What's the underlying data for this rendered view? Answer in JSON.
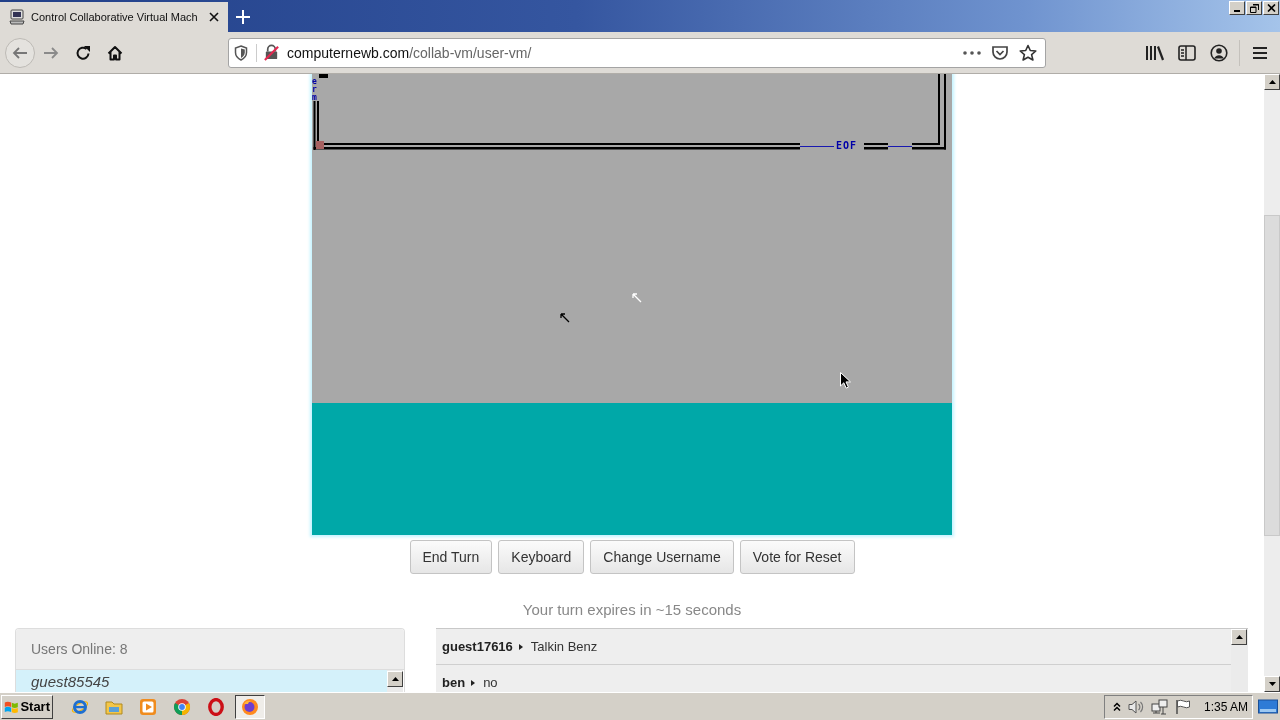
{
  "browser": {
    "tabs": [
      {
        "title": "Control Collaborative Virtual Mach",
        "selected": true
      }
    ],
    "address": {
      "host": "computernewb.com",
      "path": "/collab-vm/user-vm/"
    }
  },
  "vm_screen": {
    "vertical_label": "erm",
    "status_label": "EOF"
  },
  "controls": {
    "buttons": [
      "End Turn",
      "Keyboard",
      "Change Username",
      "Vote for Reset"
    ],
    "turn_notice": "Your turn expires in ~15 seconds"
  },
  "users_panel": {
    "header": "Users Online: 8",
    "users": [
      {
        "name": "guest85545",
        "has_turn": true
      }
    ]
  },
  "chat": {
    "messages": [
      {
        "user": "guest17616",
        "text": "Talkin Benz"
      },
      {
        "user": "ben",
        "text": "no"
      }
    ]
  },
  "taskbar": {
    "start_label": "Start",
    "apps": [
      {
        "active": false
      },
      {
        "active": false
      },
      {
        "active": false
      },
      {
        "active": false
      },
      {
        "active": false
      },
      {
        "active": true
      }
    ],
    "clock": "1:35 AM"
  }
}
